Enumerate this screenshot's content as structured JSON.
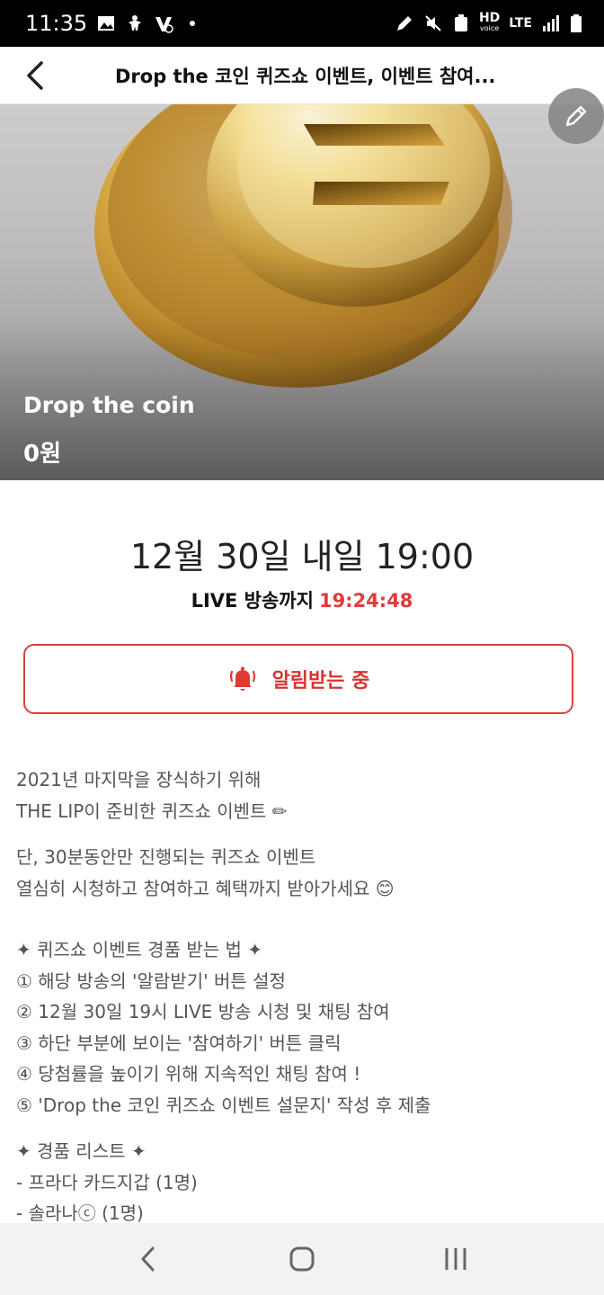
{
  "status_bar": {
    "time": "11:35",
    "hd_label": "HD",
    "hd_sub": "voice",
    "lte_label": "LTE"
  },
  "header": {
    "title": "Drop the 코인 퀴즈쇼 이벤트, 이벤트 참여..."
  },
  "hero": {
    "name": "Drop the coin",
    "price": "0원"
  },
  "schedule": {
    "datetime": "12월 30일 내일 19:00",
    "countdown_label": "LIVE 방송까지",
    "countdown_value": "19:24:48"
  },
  "alarm_button": {
    "label": "알림받는 중"
  },
  "description": {
    "lines": [
      "2021년 마지막을 장식하기 위해",
      "THE LIP이 준비한 퀴즈쇼 이벤트 ✏",
      "",
      "단, 30분동안만 진행되는 퀴즈쇼 이벤트",
      "열심히 시청하고 참여하고 혜택까지 받아가세요 😊",
      "",
      "✦ 퀴즈쇼 이벤트 경품 받는 법 ✦",
      "① 해당 방송의 '알람받기' 버튼 설정",
      "② 12월 30일 19시 LIVE 방송 시청 및 채팅 참여",
      "③ 하단 부분에 보이는 '참여하기' 버튼 클릭",
      "④ 당첨률을 높이기 위해 지속적인 채팅 참여 !",
      "⑤ 'Drop the 코인 퀴즈쇼 이벤트 설문지' 작성 후 제출",
      "",
      "✦ 경품 리스트 ✦",
      "- 프라다 카드지갑 (1명)",
      "- 솔라나ⓒ (1명)"
    ]
  },
  "colors": {
    "accent": "#d9342f",
    "status_bar": "#000000",
    "nav_bar": "#f2f2f2"
  }
}
